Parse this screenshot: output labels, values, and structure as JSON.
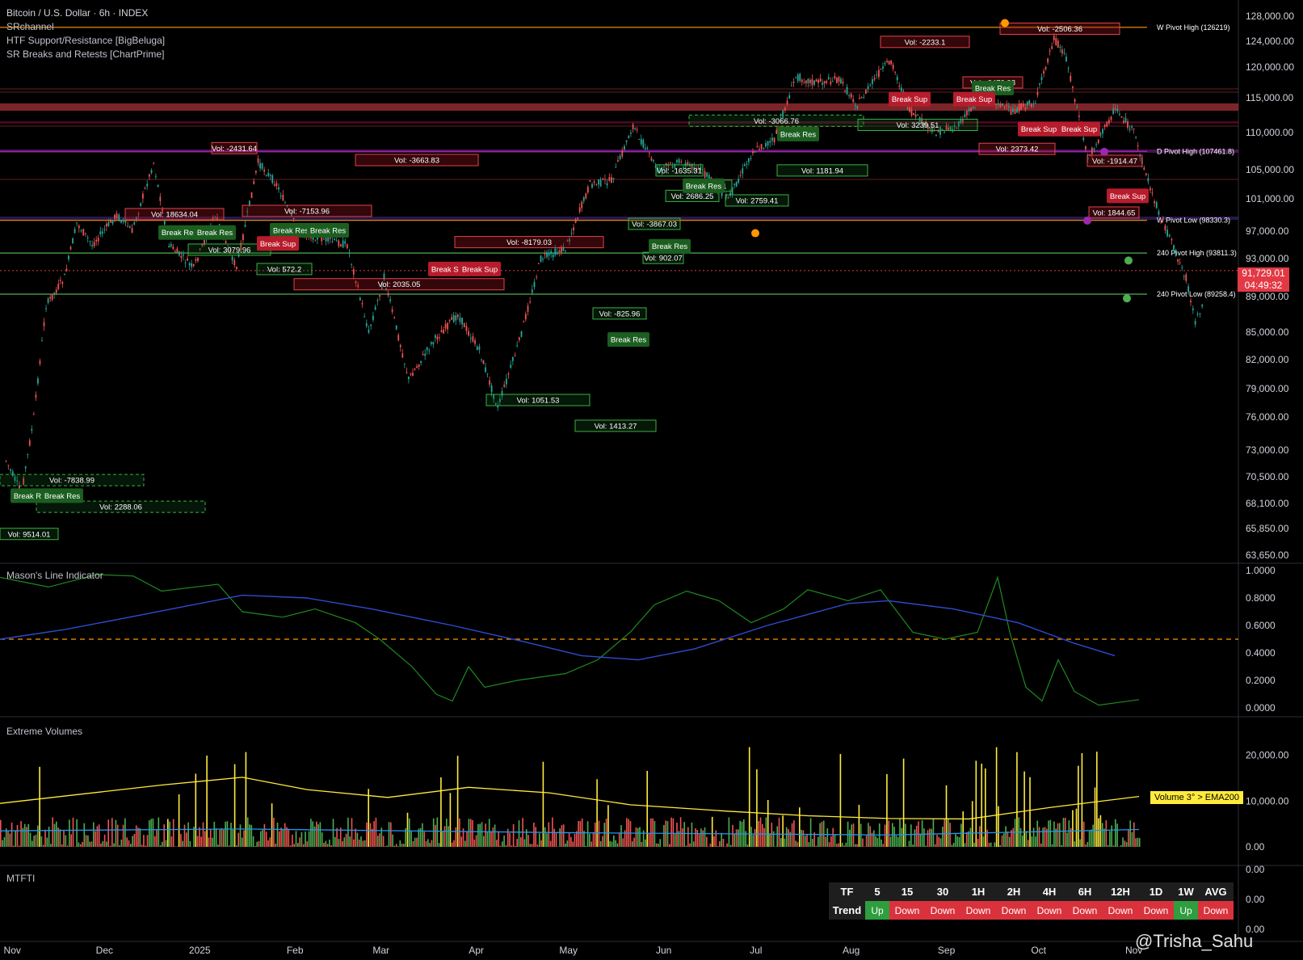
{
  "header": {
    "symbol": "Bitcoin / U.S. Dollar · 6h · INDEX",
    "indicators": [
      "SRchannel",
      "HTF Support/Resistance [BigBeluga]",
      "SR Breaks and Retests [ChartPrime]"
    ]
  },
  "panes": {
    "mason": "Mason's Line Indicator",
    "volumes": "Extreme Volumes",
    "mtfti": "MTFTI"
  },
  "last_price": "91,729.01",
  "countdown": "04:49:32",
  "volume_tag": "Volume 3° > EMA200",
  "watermark": "@Trisha_Sahu",
  "colors": {
    "up": "#26a69a",
    "down": "#ef5350",
    "bg": "#000000",
    "accent_red": "#e23a45",
    "support": "#2e9e3e"
  },
  "mtfti": {
    "header": [
      "TF",
      "5",
      "15",
      "30",
      "1H",
      "2H",
      "4H",
      "6H",
      "12H",
      "1D",
      "1W",
      "AVG"
    ],
    "row_label": "Trend",
    "values": [
      "Up",
      "Down",
      "Down",
      "Down",
      "Down",
      "Down",
      "Down",
      "Down",
      "Down",
      "Up",
      "Down"
    ]
  },
  "chart_data": [
    {
      "type": "line",
      "name": "price",
      "x_ticks": [
        "Nov",
        "Dec",
        "2025",
        "Feb",
        "Mar",
        "Apr",
        "May",
        "Jun",
        "Jul",
        "Aug",
        "Sep",
        "Oct",
        "Nov",
        "Dec"
      ],
      "y_ticks": [
        "128,000.00",
        "124,000.00",
        "120,000.00",
        "115,000.00",
        "110,000.00",
        "105,000.00",
        "101,000.00",
        "97,000.00",
        "93,000.00",
        "89,000.00",
        "85,000.00",
        "82,000.00",
        "79,000.00",
        "76,000.00",
        "73,000.00",
        "70,500.00",
        "68,100.00",
        "65,850.00",
        "63,650.00"
      ],
      "ylim": [
        62800,
        129500
      ],
      "x": [
        "2024-10-30",
        "2024-11-04",
        "2024-11-08",
        "2024-11-12",
        "2024-11-18",
        "2024-11-22",
        "2024-11-27",
        "2024-12-05",
        "2024-12-10",
        "2024-12-17",
        "2024-12-22",
        "2024-12-30",
        "2025-01-06",
        "2025-01-13",
        "2025-01-20",
        "2025-01-26",
        "2025-02-02",
        "2025-02-09",
        "2025-02-18",
        "2025-02-25",
        "2025-03-02",
        "2025-03-10",
        "2025-03-18",
        "2025-03-26",
        "2025-04-02",
        "2025-04-08",
        "2025-04-15",
        "2025-04-22",
        "2025-04-30",
        "2025-05-08",
        "2025-05-15",
        "2025-05-22",
        "2025-05-30",
        "2025-06-06",
        "2025-06-13",
        "2025-06-22",
        "2025-06-30",
        "2025-07-07",
        "2025-07-14",
        "2025-07-20",
        "2025-07-28",
        "2025-08-03",
        "2025-08-10",
        "2025-08-14",
        "2025-08-20",
        "2025-08-28",
        "2025-09-05",
        "2025-09-13",
        "2025-09-22",
        "2025-09-30",
        "2025-10-06",
        "2025-10-10",
        "2025-10-17",
        "2025-10-26",
        "2025-11-01",
        "2025-11-07",
        "2025-11-14",
        "2025-11-18",
        "2025-11-21",
        "2025-11-24"
      ],
      "y": [
        72000,
        69000,
        76000,
        88000,
        91000,
        98000,
        95000,
        99000,
        97000,
        106000,
        95000,
        92000,
        99000,
        92000,
        106000,
        103000,
        97000,
        96000,
        95000,
        85000,
        91000,
        80000,
        84000,
        87000,
        83000,
        77000,
        84000,
        93000,
        94500,
        103000,
        103500,
        111000,
        105000,
        106000,
        105000,
        101000,
        107500,
        109000,
        118500,
        117500,
        118000,
        114000,
        119000,
        121000,
        113000,
        110000,
        111000,
        116000,
        113000,
        114500,
        124500,
        121500,
        106500,
        113500,
        110000,
        101500,
        94500,
        91000,
        86000,
        88500
      ]
    },
    {
      "type": "line",
      "name": "mason",
      "y_ticks": [
        "1.0000",
        "0.8000",
        "0.6000",
        "0.4000",
        "0.2000",
        "0.0000"
      ],
      "ylim": [
        0,
        1
      ],
      "threshold": 0.5
    },
    {
      "type": "bar",
      "name": "volumes",
      "y_ticks": [
        "20,000.00",
        "10,000.00",
        "0.00"
      ]
    },
    {
      "type": "table",
      "name": "mtfti",
      "y_ticks": [
        "0.00",
        "0.00",
        "0.00"
      ]
    }
  ],
  "levels": [
    {
      "label": "W Pivot High (126219)",
      "price": 126219,
      "color": "#ff9800"
    },
    {
      "label": "D Pivot High (107461.8)",
      "price": 107461.8,
      "color": "#9c27b0"
    },
    {
      "label": "W Pivot Low (98330.3)",
      "price": 98330.3,
      "color": "#ff9800"
    },
    {
      "label": "240 Pivot High (93811.3)",
      "price": 93811.3,
      "color": "#4caf50"
    },
    {
      "label": "240 Pivot Low (89258.4)",
      "price": 89258.4,
      "color": "#4caf50"
    }
  ],
  "vol_boxes": [
    {
      "t": "Vol: -2506.36",
      "x": 1238,
      "w": 148,
      "p": 126000,
      "c": "r"
    },
    {
      "t": "Vol: -2233.1",
      "x": 1090,
      "w": 110,
      "p": 123900,
      "c": "r"
    },
    {
      "t": "Vol: -2473.38",
      "x": 1192,
      "w": 74,
      "p": 117500,
      "c": "r"
    },
    {
      "t": "Vol: -3066.76",
      "x": 853,
      "w": 216,
      "p": 111700,
      "c": "g"
    },
    {
      "t": "Vol: 3239.51",
      "x": 1062,
      "w": 148,
      "p": 111100,
      "c": "g"
    },
    {
      "t": "Vol: -2431.64",
      "x": 262,
      "w": 56,
      "p": 107900,
      "c": "r"
    },
    {
      "t": "Vol: -3663.83",
      "x": 440,
      "w": 152,
      "p": 106300,
      "c": "r"
    },
    {
      "t": "Vol: 2373.42",
      "x": 1212,
      "w": 94,
      "p": 107800,
      "c": "r"
    },
    {
      "t": "Vol: -1914.47",
      "x": 1346,
      "w": 68,
      "p": 106200,
      "c": "r"
    },
    {
      "t": "Vol: 1181.94",
      "x": 962,
      "w": 112,
      "p": 104900,
      "c": "g"
    },
    {
      "t": "Vol: -1635.31",
      "x": 812,
      "w": 58,
      "p": 104900,
      "c": "g"
    },
    {
      "t": "Vol: 891.11",
      "x": 846,
      "w": 60,
      "p": 102800,
      "c": "g"
    },
    {
      "t": "Vol: 2686.25",
      "x": 824,
      "w": 66,
      "p": 101400,
      "c": "g"
    },
    {
      "t": "Vol: 2759.41",
      "x": 898,
      "w": 78,
      "p": 100800,
      "c": "g"
    },
    {
      "t": "Vol: -7153.96",
      "x": 300,
      "w": 160,
      "p": 99500,
      "c": "r"
    },
    {
      "t": "Vol: 18634.04",
      "x": 155,
      "w": 122,
      "p": 99100,
      "c": "r"
    },
    {
      "t": "Vol: 1844.65",
      "x": 1348,
      "w": 62,
      "p": 99300,
      "c": "r"
    },
    {
      "t": "Vol: -3867.03",
      "x": 778,
      "w": 64,
      "p": 97900,
      "c": "g"
    },
    {
      "t": "Vol: -8179.03",
      "x": 563,
      "w": 184,
      "p": 95400,
      "c": "r"
    },
    {
      "t": "Vol: 3079.96",
      "x": 233,
      "w": 102,
      "p": 94300,
      "c": "g"
    },
    {
      "t": "Vol: 902.07",
      "x": 796,
      "w": 50,
      "p": 93100,
      "c": "g"
    },
    {
      "t": "Vol: 572.2",
      "x": 318,
      "w": 68,
      "p": 91900,
      "c": "g"
    },
    {
      "t": "Vol: 2035.05",
      "x": 364,
      "w": 260,
      "p": 90300,
      "c": "r"
    },
    {
      "t": "Vol: -825.96",
      "x": 734,
      "w": 66,
      "p": 87100,
      "c": "g"
    },
    {
      "t": "Vol: 1051.53",
      "x": 602,
      "w": 128,
      "p": 77800,
      "c": "g"
    },
    {
      "t": "Vol: 1413.27",
      "x": 712,
      "w": 100,
      "p": 75200,
      "c": "g"
    },
    {
      "t": "Vol: -7838.99",
      "x": 0,
      "w": 178,
      "p": 70200,
      "c": "g"
    },
    {
      "t": "Vol: 2288.06",
      "x": 45,
      "w": 209,
      "p": 67800,
      "c": "g"
    },
    {
      "t": "Vol: 9514.01",
      "x": 0,
      "w": 72,
      "p": 65400,
      "c": "g"
    }
  ],
  "break_labels": [
    {
      "t": "Break Res",
      "x": 1203,
      "p": 116600,
      "c": "g"
    },
    {
      "t": "Break Sup",
      "x": 1100,
      "p": 114800,
      "c": "r"
    },
    {
      "t": "Break Sup",
      "x": 1180,
      "p": 114800,
      "c": "r"
    },
    {
      "t": "Break Res",
      "x": 962,
      "p": 109800,
      "c": "g"
    },
    {
      "t": "Break Sup",
      "x": 1260,
      "p": 110500,
      "c": "r"
    },
    {
      "t": "Break Sup",
      "x": 1310,
      "p": 110500,
      "c": "r"
    },
    {
      "t": "Break Res",
      "x": 845,
      "p": 102800,
      "c": "g"
    },
    {
      "t": "Break Sup",
      "x": 1370,
      "p": 101400,
      "c": "r"
    },
    {
      "t": "Break Res",
      "x": 196,
      "p": 96800,
      "c": "g"
    },
    {
      "t": "Break Res",
      "x": 240,
      "p": 96800,
      "c": "g"
    },
    {
      "t": "Break Res",
      "x": 334,
      "p": 97100,
      "c": "g"
    },
    {
      "t": "Break Res",
      "x": 380,
      "p": 97100,
      "c": "g"
    },
    {
      "t": "Break Sup",
      "x": 318,
      "p": 95200,
      "c": "r"
    },
    {
      "t": "Break Res",
      "x": 803,
      "p": 94800,
      "c": "g"
    },
    {
      "t": "Break Sup",
      "x": 530,
      "p": 91900,
      "c": "r"
    },
    {
      "t": "Break Sup",
      "x": 568,
      "p": 91900,
      "c": "r"
    },
    {
      "t": "Break Res",
      "x": 752,
      "p": 84200,
      "c": "g"
    },
    {
      "t": "Break Res",
      "x": 13,
      "p": 68800,
      "c": "g"
    },
    {
      "t": "Break Res",
      "x": 51,
      "p": 68800,
      "c": "g"
    }
  ]
}
